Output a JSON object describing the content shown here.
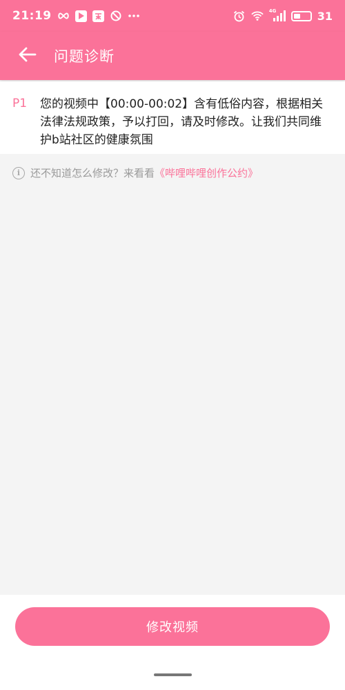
{
  "status_bar": {
    "time": "21:19",
    "battery_level": "31",
    "network_label": "4G"
  },
  "app_bar": {
    "title": "问题诊断"
  },
  "issue": {
    "tag": "P1",
    "text": "您的视频中【00:00-00:02】含有低俗内容，根据相关法律法规政策，予以打回，请及时修改。让我们共同维护b站社区的健康氛围"
  },
  "tip": {
    "text": "还不知道怎么修改？来看看",
    "link": "《哔哩哔哩创作公约》"
  },
  "actions": {
    "modify_label": "修改视频"
  },
  "colors": {
    "accent": "#fb7299",
    "background": "#f4f4f4"
  }
}
